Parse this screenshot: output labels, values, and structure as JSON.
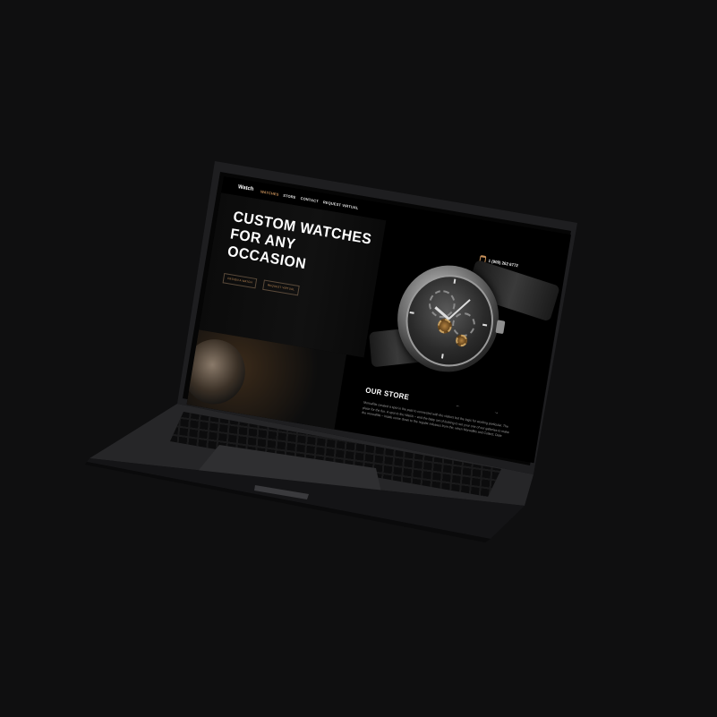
{
  "nav": {
    "logo": "Watch",
    "items": [
      {
        "label": "WATCHES",
        "active": true
      },
      {
        "label": "STORE",
        "active": false
      },
      {
        "label": "CONTACT",
        "active": false
      },
      {
        "label": "REQUEST VIRTUAL",
        "active": false
      }
    ]
  },
  "hero": {
    "title_line1": "CUSTOM WATCHES",
    "title_line2": "FOR ANY",
    "title_line3": "OCCASION",
    "primary_button": "DESIGN A WATCH",
    "secondary_button": "REQUEST VIRTUAL"
  },
  "contact": {
    "phone_icon": "phone-icon",
    "phone": "1 (909) 262 6772"
  },
  "store": {
    "title": "OUR STORE",
    "prev_icon": "arrow-left-icon",
    "next_icon": "arrow-right-icon",
    "prev_symbol": "←",
    "next_symbol": "→",
    "paragraph": "Moroafitis created a spot in the past to connected with the visitors but the logic for working particular. The place for the fun. A spot to the Watch – and the baby set of looking to set your one of our galleries to make the moroafitis – inside come down to the regular releases from the, when Moroafitis and Collect, Date"
  },
  "colors": {
    "background": "#0f0f10",
    "accent": "#c8915a",
    "screen": "#000000"
  }
}
